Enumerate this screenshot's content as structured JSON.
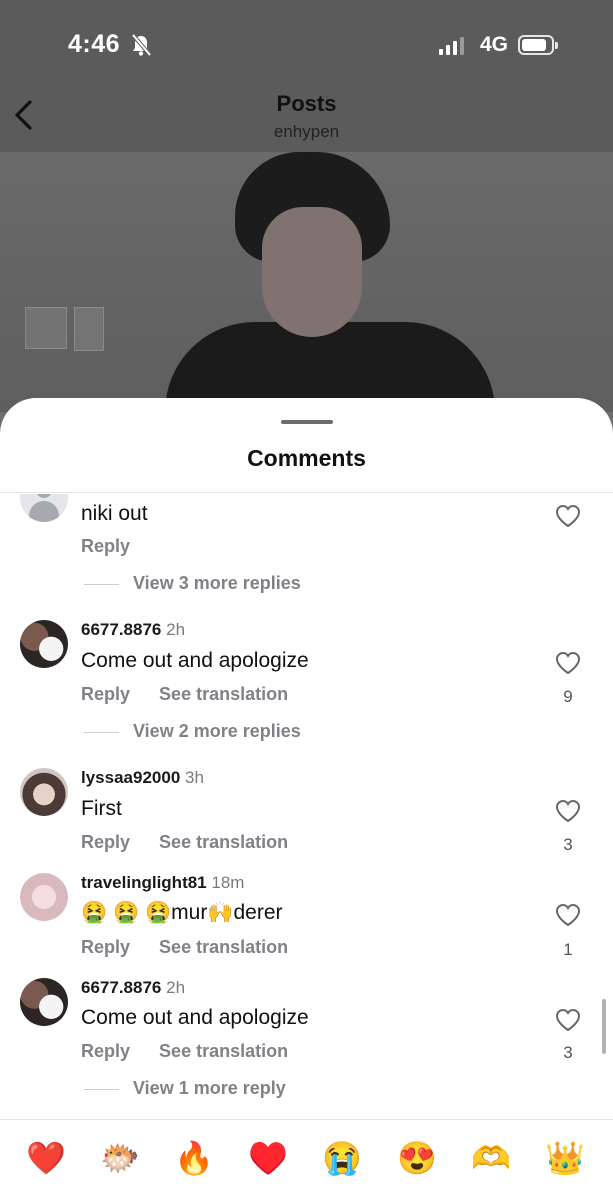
{
  "status_bar": {
    "time": "4:46",
    "network": "4G"
  },
  "header": {
    "title": "Posts",
    "subtitle": "enhypen"
  },
  "sheet": {
    "title": "Comments"
  },
  "comments": [
    {
      "username": "",
      "time": "",
      "text": "niki out",
      "reply_label": "Reply",
      "translation_label": "",
      "likes": "",
      "view_more": "View 3 more replies"
    },
    {
      "username": "6677.8876",
      "time": "2h",
      "text": "Come out and apologize",
      "reply_label": "Reply",
      "translation_label": "See translation",
      "likes": "9",
      "view_more": "View 2 more replies"
    },
    {
      "username": "lyssaa92000",
      "time": "3h",
      "text": "First",
      "reply_label": "Reply",
      "translation_label": "See translation",
      "likes": "3",
      "view_more": ""
    },
    {
      "username": "travelinglight81",
      "time": "18m",
      "text_parts": [
        "🤮",
        "🤮",
        "🤮",
        "mur",
        "🙌",
        "derer"
      ],
      "reply_label": "Reply",
      "translation_label": "See translation",
      "likes": "1",
      "view_more": ""
    },
    {
      "username": "6677.8876",
      "time": "2h",
      "text": "Come out and apologize",
      "reply_label": "Reply",
      "translation_label": "See translation",
      "likes": "3",
      "view_more": "View 1 more reply"
    }
  ],
  "reactions": [
    "❤️",
    "🐡",
    "🔥",
    "♥️",
    "😭",
    "😍",
    "🫶",
    "👑"
  ]
}
